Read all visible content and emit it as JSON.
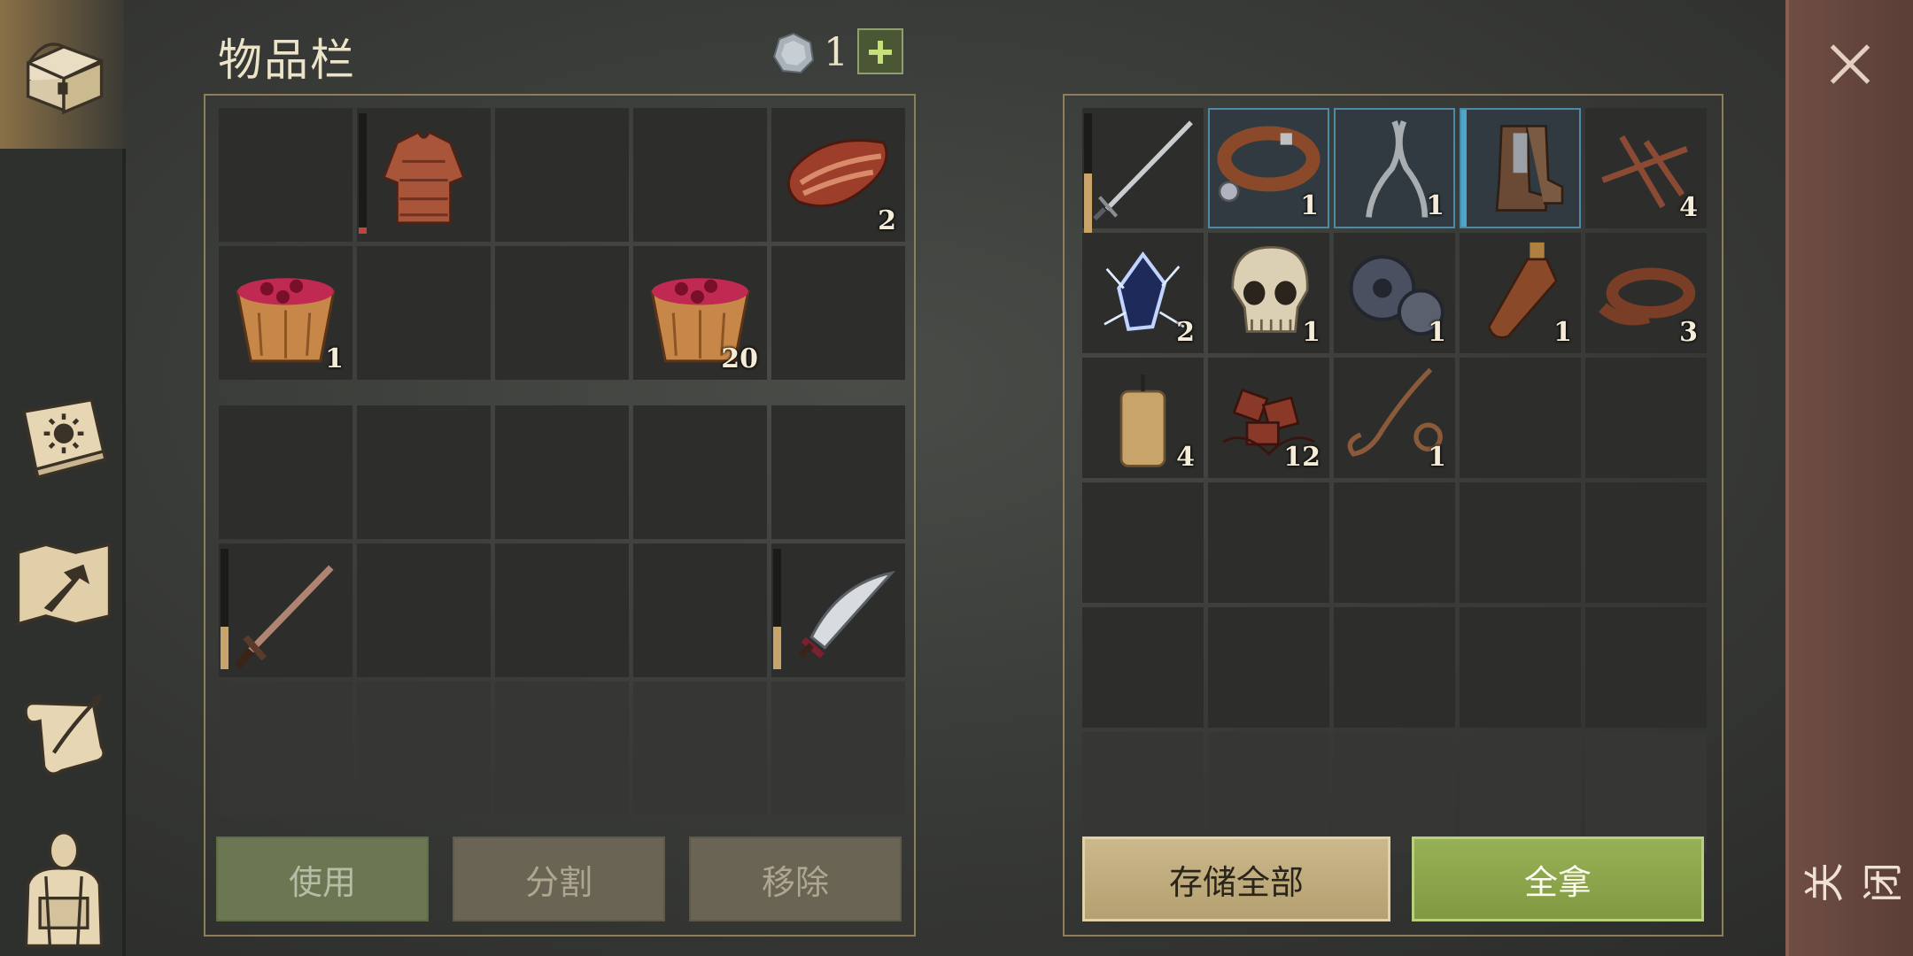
{
  "inventory": {
    "title": "物品栏",
    "coin_count": "1",
    "buttons": {
      "use": "使用",
      "split": "分割",
      "remove": "移除"
    },
    "top_slots": [
      {
        "item": "empty",
        "count": ""
      },
      {
        "item": "chainmail-shirt-icon",
        "count": "",
        "durability": 0.05,
        "dur_color": "#c0443c"
      },
      {
        "item": "empty",
        "count": ""
      },
      {
        "item": "empty",
        "count": ""
      },
      {
        "item": "raw-meat-icon",
        "count": "2"
      },
      {
        "item": "berry-bucket-icon",
        "count": "1"
      },
      {
        "item": "empty",
        "count": ""
      },
      {
        "item": "empty",
        "count": ""
      },
      {
        "item": "berry-bucket-icon",
        "count": "20"
      },
      {
        "item": "empty",
        "count": ""
      }
    ],
    "bottom_slots": [
      {
        "item": "empty"
      },
      {
        "item": "empty"
      },
      {
        "item": "empty"
      },
      {
        "item": "empty"
      },
      {
        "item": "empty"
      },
      {
        "item": "sword-icon",
        "durability": 0.35,
        "dur_color": "#c8a46a"
      },
      {
        "item": "empty"
      },
      {
        "item": "empty"
      },
      {
        "item": "empty"
      },
      {
        "item": "scimitar-icon",
        "durability": 0.35,
        "dur_color": "#c8a46a"
      },
      {
        "item": "empty",
        "dim": true
      },
      {
        "item": "empty",
        "dim": true
      },
      {
        "item": "empty",
        "dim": true
      },
      {
        "item": "empty",
        "dim": true
      },
      {
        "item": "empty",
        "dim": true
      }
    ]
  },
  "storage": {
    "buttons": {
      "store_all": "存储全部",
      "take_all": "全拿"
    },
    "slots": [
      {
        "item": "longsword-icon",
        "count": "",
        "durability": 0.5,
        "dur_color": "#c8a46a"
      },
      {
        "item": "leather-collar-icon",
        "count": "1",
        "highlight": true
      },
      {
        "item": "pliers-icon",
        "count": "1",
        "highlight": true
      },
      {
        "item": "boots-icon",
        "count": "",
        "highlight": true,
        "bar": true
      },
      {
        "item": "nails-icon",
        "count": "4"
      },
      {
        "item": "crystal-icon",
        "count": "2"
      },
      {
        "item": "skull-icon",
        "count": "1"
      },
      {
        "item": "gear-icon",
        "count": "1"
      },
      {
        "item": "bottle-icon",
        "count": "1"
      },
      {
        "item": "leather-strap-icon",
        "count": "3"
      },
      {
        "item": "candle-icon",
        "count": "4"
      },
      {
        "item": "scrap-icon",
        "count": "12"
      },
      {
        "item": "rope-icon",
        "count": "1"
      },
      {
        "item": "empty"
      },
      {
        "item": "empty"
      },
      {
        "item": "empty"
      },
      {
        "item": "empty"
      },
      {
        "item": "empty"
      },
      {
        "item": "empty"
      },
      {
        "item": "empty"
      },
      {
        "item": "empty"
      },
      {
        "item": "empty"
      },
      {
        "item": "empty"
      },
      {
        "item": "empty"
      },
      {
        "item": "empty"
      },
      {
        "item": "empty",
        "dim": true
      },
      {
        "item": "empty",
        "dim": true
      },
      {
        "item": "empty",
        "dim": true
      },
      {
        "item": "empty",
        "dim": true
      },
      {
        "item": "empty",
        "dim": true
      }
    ]
  },
  "sidebar": {
    "items": [
      {
        "name": "chest-icon"
      },
      {
        "name": "sun-book-icon"
      },
      {
        "name": "crafting-map-icon"
      },
      {
        "name": "scroll-icon"
      },
      {
        "name": "character-icon"
      }
    ]
  },
  "close": {
    "label": "关闭"
  }
}
